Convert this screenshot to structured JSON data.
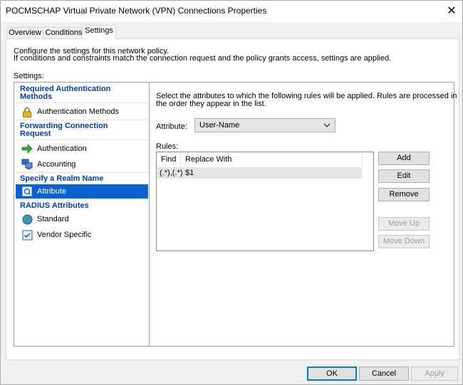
{
  "window": {
    "title": "POCMSCHAP Virtual Private Network (VPN) Connections Properties",
    "close_glyph": "✕"
  },
  "tabs": [
    {
      "label": "Overview"
    },
    {
      "label": "Conditions"
    },
    {
      "label": "Settings",
      "active": true
    }
  ],
  "intro": {
    "line1": "Configure the settings for this network policy.",
    "line2": "If conditions and constraints match the connection request and the policy grants access, settings are applied.",
    "settings_label": "Settings:"
  },
  "nav": {
    "required_auth_header_1": "Required Authentication",
    "required_auth_header_2": "Methods",
    "auth_methods": "Authentication Methods",
    "forwarding_header_1": "Forwarding Connection",
    "forwarding_header_2": "Request",
    "authentication": "Authentication",
    "accounting": "Accounting",
    "realm_header": "Specify a Realm Name",
    "attribute": "Attribute",
    "radius_header": "RADIUS Attributes",
    "standard": "Standard",
    "vendor_specific": "Vendor Specific",
    "selected": "Attribute"
  },
  "detail": {
    "desc1": "Select the attributes to which the following rules will be applied. Rules are processed in",
    "desc2": "the order they appear in the list.",
    "attribute_label": "Attribute:",
    "attribute_value": "User-Name",
    "rules_label": "Rules:",
    "columns": {
      "find": "Find",
      "replace": "Replace With"
    },
    "rows": [
      {
        "find": "(.*),(.*)",
        "replace": "$1"
      }
    ],
    "buttons": {
      "add": "Add",
      "edit": "Edit",
      "remove": "Remove",
      "move_up": "Move Up",
      "move_down": "Move Down"
    }
  },
  "footer": {
    "ok": "OK",
    "cancel": "Cancel",
    "apply": "Apply"
  },
  "colors": {
    "header_blue": "#003dad",
    "selection": "#0a62d0"
  }
}
